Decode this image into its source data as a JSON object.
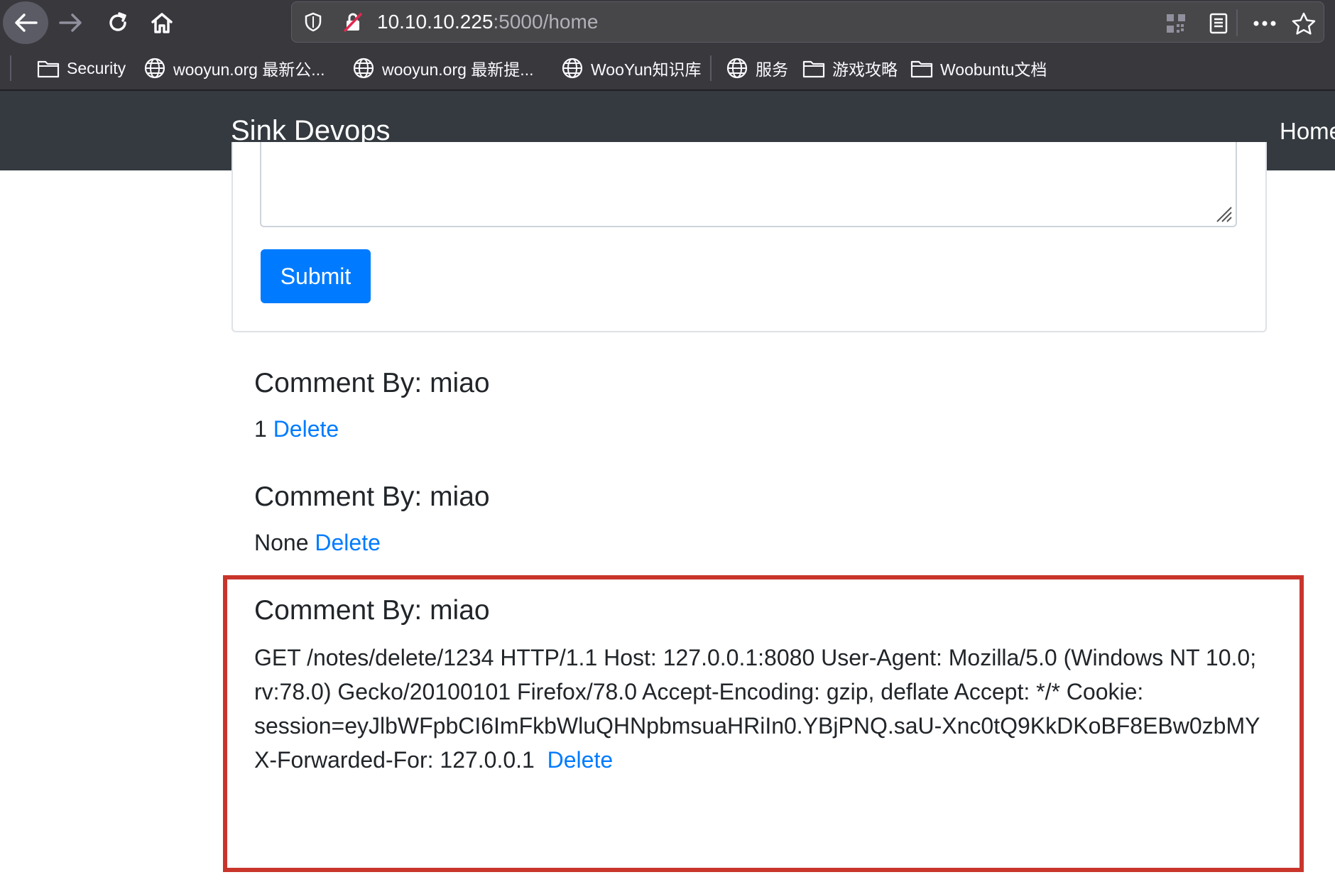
{
  "browser": {
    "url_host": "10.10.10.225",
    "url_rest": ":5000/home",
    "icons": [
      "back-arrow-icon",
      "forward-arrow-icon",
      "reload-icon",
      "home-icon",
      "shield-icon",
      "insecure-lock-icon",
      "qr-code-icon",
      "reader-view-icon",
      "more-icon",
      "star-icon"
    ]
  },
  "bookmarks": [
    {
      "label": "Security",
      "icon": "folder-icon"
    },
    {
      "label": "wooyun.org 最新公...",
      "icon": "globe-icon"
    },
    {
      "label": "wooyun.org 最新提...",
      "icon": "globe-icon"
    },
    {
      "label": "WooYun知识库",
      "icon": "globe-icon"
    },
    {
      "label": "服务",
      "icon": "globe-icon"
    },
    {
      "label": "游戏攻略",
      "icon": "folder-icon"
    },
    {
      "label": "Woobuntu文档",
      "icon": "folder-icon"
    }
  ],
  "navbar": {
    "brand": "Sink Devops",
    "home": "Home"
  },
  "form": {
    "submit_label": "Submit"
  },
  "comments": [
    {
      "title": "Comment By: miao",
      "body": "1",
      "delete_label": "Delete"
    },
    {
      "title": "Comment By: miao",
      "body": "None",
      "delete_label": "Delete"
    },
    {
      "title": "Comment By: miao",
      "body_lines": [
        "GET /notes/delete/1234 HTTP/1.1 Host: 127.0.0.1:8080 User-Agent: Mozilla/5.0 (Windows NT 10.0;",
        "rv:78.0) Gecko/20100101 Firefox/78.0 Accept-Encoding: gzip, deflate Accept: */* Cookie:",
        "session=eyJlbWFpbCI6ImFkbWluQHNpbmsuaHRiIn0.YBjPNQ.saU-Xnc0tQ9KkDKoBF8EBw0zbMY",
        "X-Forwarded-For: 127.0.0.1 "
      ],
      "delete_label": "Delete"
    }
  ],
  "colors": {
    "navbar_bg": "#343a40",
    "primary": "#007bff",
    "highlight": "#c9352b"
  }
}
